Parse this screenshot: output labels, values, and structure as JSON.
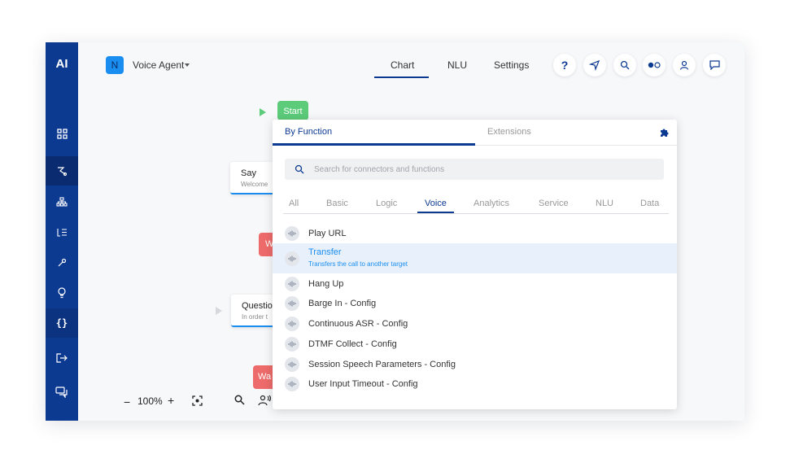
{
  "sidebar": {
    "logo": "AI",
    "items": [
      {
        "icon": "grid-icon"
      },
      {
        "icon": "flow-icon"
      },
      {
        "icon": "hierarchy-icon"
      },
      {
        "icon": "list-icon"
      },
      {
        "icon": "wrench-icon"
      },
      {
        "icon": "lightbulb-icon"
      },
      {
        "icon": "code-braces-icon",
        "label": "{}"
      },
      {
        "icon": "logout-icon"
      },
      {
        "icon": "chat-icon"
      }
    ]
  },
  "header": {
    "project_badge": "N",
    "project_name": "Voice Agent",
    "tabs": [
      "Chart",
      "NLU",
      "Settings"
    ],
    "active_tab": "Chart",
    "help_label": "?"
  },
  "canvas": {
    "start_label": "Start",
    "say_title": "Say",
    "say_sub": "Welcome",
    "red1_label": "W",
    "question_title": "Questio",
    "question_sub": "In order t",
    "red2_label": "Wa",
    "zoom_minus": "−",
    "zoom_level": "100%",
    "zoom_plus": "+"
  },
  "panel": {
    "tab_by_function": "By Function",
    "tab_extensions": "Extensions",
    "search_placeholder": "Search for connectors and functions",
    "filter_tabs": [
      "All",
      "Basic",
      "Logic",
      "Voice",
      "Analytics",
      "Service",
      "NLU",
      "Data"
    ],
    "active_filter": "Voice",
    "items": [
      {
        "title": "Play URL"
      },
      {
        "title": "Transfer",
        "subtitle": "Transfers the call to another target",
        "selected": true
      },
      {
        "title": "Hang Up"
      },
      {
        "title": "Barge In - Config"
      },
      {
        "title": "Continuous ASR - Config"
      },
      {
        "title": "DTMF Collect - Config"
      },
      {
        "title": "Session Speech Parameters - Config"
      },
      {
        "title": "User Input Timeout - Config"
      }
    ]
  },
  "colors": {
    "sidebar": "#0d3a91",
    "accent": "#1a8ef0",
    "start": "#5ccb7a",
    "error_node": "#ee6b6b"
  }
}
